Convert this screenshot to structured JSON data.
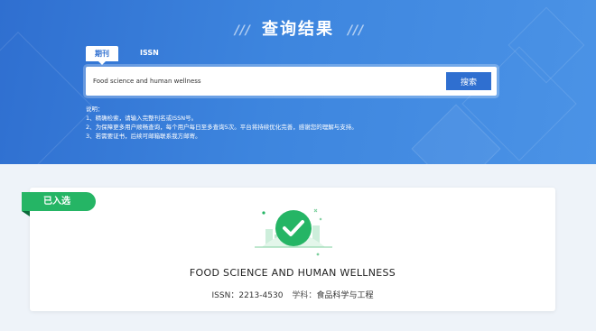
{
  "banner": {
    "title": "查询结果",
    "slashes_left": "/ / /",
    "slashes_right": "/ / /"
  },
  "tabs": [
    {
      "label": "期刊",
      "active": true
    },
    {
      "label": "ISSN",
      "active": false
    }
  ],
  "search": {
    "value": "Food science and human wellness",
    "button_label": "搜索"
  },
  "notes": {
    "heading": "说明：",
    "items": [
      "1、精确检索，请输入完整刊名或ISSN号。",
      "2、为保障更多用户顺畅查询，每个用户每日至多查询5次。平台将持续优化完善，感谢您的理解与支持。",
      "3、若需要证书，后续可邮箱联系我方邮寄。"
    ]
  },
  "result": {
    "status_label": "已入选",
    "journal_name": "FOOD SCIENCE AND HUMAN WELLNESS",
    "issn_label": "ISSN：",
    "issn": "2213-4530",
    "subject_label": "学科：",
    "subject": "食品科学与工程"
  },
  "colors": {
    "brand_blue": "#2f6fd0",
    "success_green": "#25b565"
  },
  "icons": {
    "status_icon": "check-circle-icon"
  }
}
